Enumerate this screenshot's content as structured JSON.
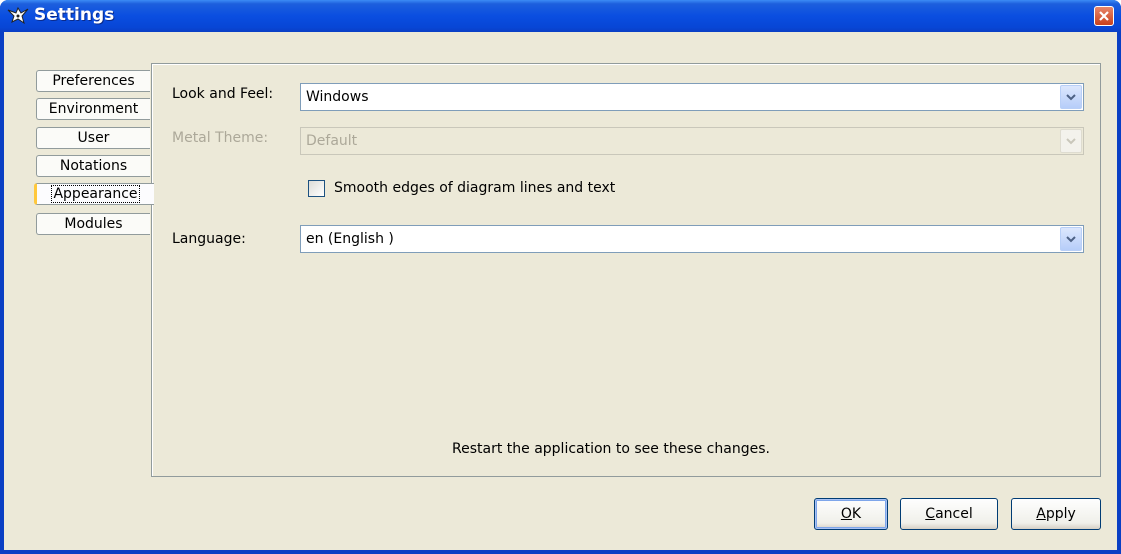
{
  "window": {
    "title": "Settings"
  },
  "tabs": [
    {
      "label": "Preferences",
      "active": false
    },
    {
      "label": "Environment",
      "active": false
    },
    {
      "label": "User",
      "active": false
    },
    {
      "label": "Notations",
      "active": false
    },
    {
      "label": "Appearance",
      "active": true
    },
    {
      "label": "Modules",
      "active": false
    }
  ],
  "appearance": {
    "look_and_feel": {
      "label": "Look and Feel:",
      "value": "Windows"
    },
    "metal_theme": {
      "label": "Metal Theme:",
      "value": "Default",
      "enabled": false
    },
    "smooth_edges": {
      "label": "Smooth edges of diagram lines and text",
      "checked": false
    },
    "language": {
      "label": "Language:",
      "value": "en (English )"
    },
    "restart_note": "Restart the application to see these changes."
  },
  "buttons": {
    "ok": {
      "mnemonic": "O",
      "rest": "K"
    },
    "cancel": {
      "mnemonic": "C",
      "rest": "ancel"
    },
    "apply": {
      "mnemonic": "A",
      "rest": "pply"
    }
  },
  "colors": {
    "title_bar": "#0a4ee0",
    "dialog_bg": "#ece9d8",
    "active_tab_accent": "#ffc83c"
  }
}
